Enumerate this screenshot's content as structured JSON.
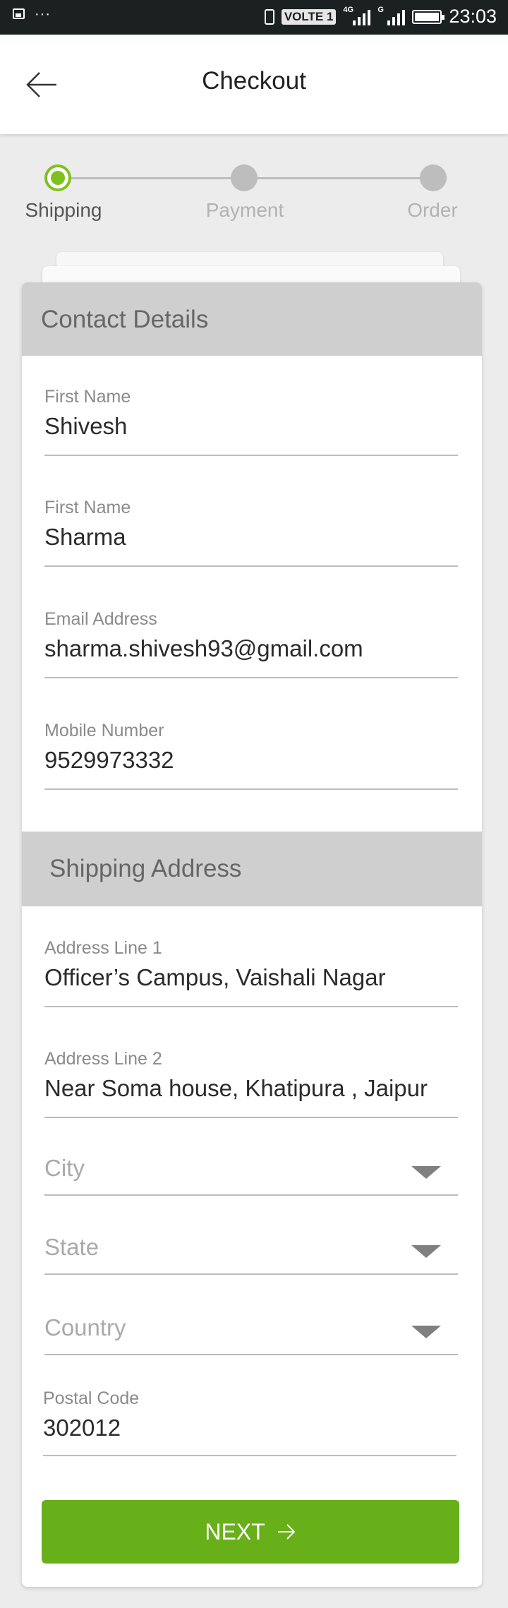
{
  "status_bar": {
    "volte": "VOLTE 1",
    "net1": "4G",
    "net2": "G",
    "time": "23:03"
  },
  "header": {
    "title": "Checkout"
  },
  "stepper": {
    "steps": [
      {
        "label": "Shipping",
        "active": true
      },
      {
        "label": "Payment",
        "active": false
      },
      {
        "label": "Order",
        "active": false
      }
    ],
    "active_color": "#7ec11f"
  },
  "contact": {
    "title": "Contact Details",
    "fields": [
      {
        "label": "First Name",
        "value": "Shivesh"
      },
      {
        "label": "First Name",
        "value": "Sharma"
      },
      {
        "label": "Email Address",
        "value": "sharma.shivesh93@gmail.com"
      },
      {
        "label": "Mobile Number",
        "value": "9529973332"
      }
    ]
  },
  "shipping": {
    "title": "Shipping Address",
    "address1": {
      "label": "Address Line 1",
      "value": "Officer’s Campus, Vaishali Nagar"
    },
    "address2": {
      "label": "Address Line 2",
      "value": "Near Soma house, Khatipura , Jaipur"
    },
    "city": {
      "placeholder": "City"
    },
    "state": {
      "placeholder": "State"
    },
    "country": {
      "placeholder": "Country"
    },
    "postal": {
      "label": "Postal Code",
      "value": "302012"
    }
  },
  "next_button": {
    "label": "NEXT",
    "color": "#68b01a"
  }
}
